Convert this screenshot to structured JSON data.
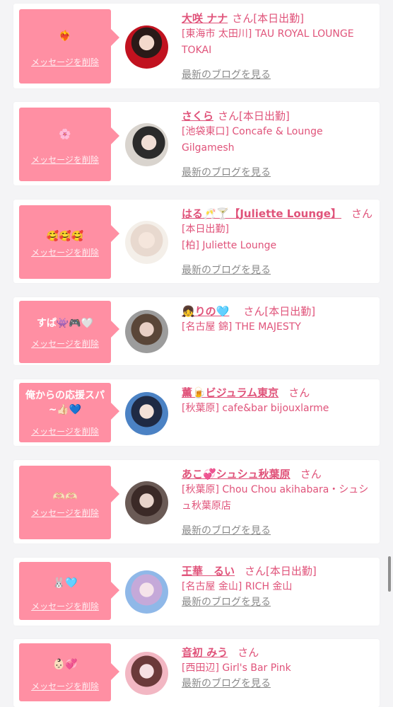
{
  "delete_label": "メッセージを削除",
  "san_label": "さん",
  "blog_label": "最新のブログを見る",
  "cards": [
    {
      "message": "❤️‍🔥",
      "name": "大咲 ナナ",
      "status": "[本日出勤]",
      "shop": "[東海市 太田川] TAU ROYAL LOUNGE TOKAI"
    },
    {
      "message": "🌸",
      "name": "さくら",
      "status": "[本日出勤]",
      "shop": "[池袋東口] Concafe & Lounge Gilgamesh"
    },
    {
      "message": "🥰🥰🥰",
      "name": "はる🥂🍸【Juliette Lounge】",
      "status": "[本日出勤]",
      "shop": "[柏] Juliette Lounge"
    },
    {
      "message": "すぱ👾🎮🤍",
      "name": "👧りの🩵",
      "status": "[本日出勤]",
      "shop": "[名古屋 錦] THE MAJESTY"
    },
    {
      "message": "俺からの応援スパ~👍🏻💙",
      "name": "薫🍺ビジュラム東京",
      "status": "",
      "shop": "[秋葉原] cafe&bar bijouxlarme"
    },
    {
      "message": "🫶🏻🫶🏻",
      "name": "あこ💞シュシュ秋葉原",
      "status": "",
      "shop": "[秋葉原] Chou Chou akihabara・シュシュ秋葉原店"
    },
    {
      "message": "🐰🩵",
      "name": "王華　るい",
      "status": "[本日出勤]",
      "shop": "[名古屋 金山] RICH 金山"
    },
    {
      "message": "👶🏻💞",
      "name": "音初 みう",
      "status": "",
      "shop": "[西田辺] Girl's Bar Pink"
    }
  ]
}
